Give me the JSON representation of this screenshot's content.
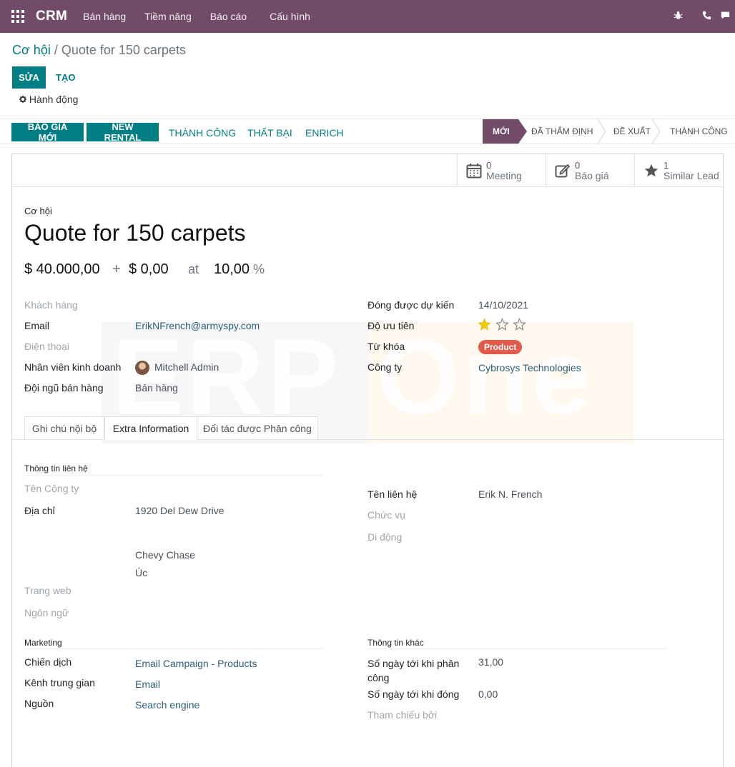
{
  "navbar": {
    "app_name": "CRM",
    "menu": [
      "Bán hàng",
      "Tiềm năng",
      "Báo cáo",
      "Cấu hình"
    ],
    "icons": [
      "bug-icon",
      "phone-icon",
      "chat-icon"
    ]
  },
  "breadcrumb": {
    "parent": "Cơ hội",
    "separator": " / ",
    "current": "Quote for 150 carpets"
  },
  "controls": {
    "edit": "SỬA",
    "create": "TẠO",
    "action": "Hành động"
  },
  "statusbar": {
    "buttons": [
      "BÁO GIÁ MỚI",
      "NEW RENTAL",
      "THÀNH CÔNG",
      "THẤT BẠI",
      "ENRICH"
    ],
    "stages": [
      "MỚI",
      "ĐÃ THẨM ĐỊNH",
      "ĐỀ XUẤT",
      "THÀNH CÔNG"
    ],
    "active_stage": "MỚI"
  },
  "smart_buttons": [
    {
      "count": "0",
      "label": "Meeting",
      "icon": "calendar-icon"
    },
    {
      "count": "0",
      "label": "Báo giá",
      "icon": "edit-icon"
    },
    {
      "count": "1",
      "label": "Similar Lead",
      "icon": "star-icon"
    }
  ],
  "record": {
    "type_label": "Cơ hội",
    "name": "Quote for 150 carpets",
    "expected_revenue": "$ 40.000,00",
    "plus": "+",
    "recurring_revenue": "$ 0,00",
    "at": "at",
    "probability": "10,00",
    "percent": "%"
  },
  "fields_left": [
    {
      "label": "Khách hàng",
      "value": "",
      "empty": true
    },
    {
      "label": "Email",
      "value": "ErikNFrench@armyspy.com"
    },
    {
      "label": "Điện thoại",
      "value": "",
      "empty": true
    },
    {
      "label": "Nhân viên kinh doanh",
      "value": "Mitchell Admin"
    },
    {
      "label": "Đội ngũ bán hàng",
      "value": "Bán hàng"
    }
  ],
  "fields_right": [
    {
      "label": "Đóng được dự kiến",
      "value": "14/10/2021"
    },
    {
      "label": "Độ ưu tiên",
      "value": ""
    },
    {
      "label": "Từ khóa",
      "value": "Product"
    },
    {
      "label": "Công ty",
      "value": "Cybrosys Technologies"
    }
  ],
  "priority": {
    "stars": 3,
    "filled": 1
  },
  "tabs": [
    "Ghi chú nội bộ",
    "Extra Information",
    "Đối tác được Phân công"
  ],
  "active_tab": "Extra Information",
  "contact_section": {
    "title": "Thông tin liên hệ",
    "company_name_label": "Tên Công ty",
    "address_label": "Địa chỉ",
    "street": "1920 Del Dew Drive",
    "city": "Chevy Chase",
    "country": "Úc",
    "website_label": "Trang web",
    "language_label": "Ngôn ngữ",
    "contact_name_label": "Tên liên hệ",
    "contact_name": "Erik N. French",
    "job_label": "Chức vụ",
    "mobile_label": "Di động"
  },
  "marketing": {
    "title": "Marketing",
    "campaign_label": "Chiến dịch",
    "campaign": "Email Campaign - Products",
    "medium_label": "Kênh trung gian",
    "medium": "Email",
    "source_label": "Nguồn",
    "source": "Search engine"
  },
  "misc": {
    "title": "Thông tin khác",
    "days_assign_label": "Số ngày tới khi phân công",
    "days_assign": "31,00",
    "days_close_label": "Số ngày tới khi đóng",
    "days_close": "0,00",
    "referred_label": "Tham chiếu bởi"
  },
  "watermark": {
    "left": "ERP",
    "right": "One"
  },
  "colors": {
    "brand": "#714B67",
    "primary": "#017e84",
    "tag": "#e25b4a",
    "star": "#f3cc00"
  }
}
